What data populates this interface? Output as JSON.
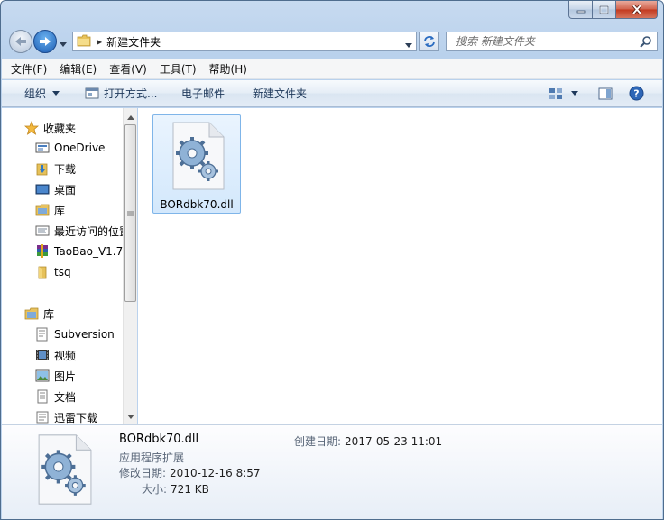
{
  "window": {
    "min_label": "minimize",
    "max_label": "maximize",
    "close_label": "close"
  },
  "address": {
    "path": "新建文件夹"
  },
  "search": {
    "placeholder": "搜索 新建文件夹"
  },
  "menu": [
    "文件(F)",
    "编辑(E)",
    "查看(V)",
    "工具(T)",
    "帮助(H)"
  ],
  "commands": {
    "organize": "组织",
    "open_with": "打开方式...",
    "email": "电子邮件",
    "new_folder": "新建文件夹"
  },
  "nav": {
    "favorites_header": "收藏夹",
    "favorites": [
      "OneDrive",
      "下载",
      "桌面",
      "库",
      "最近访问的位置",
      "TaoBao_V1.7",
      "tsq"
    ],
    "libraries_header": "库",
    "libraries": [
      "Subversion",
      "视频",
      "图片",
      "文档",
      "迅雷下载"
    ]
  },
  "files": [
    {
      "name": "BORdbk70.dll",
      "icon": "dll-gear-icon"
    }
  ],
  "details": {
    "name": "BORdbk70.dll",
    "type": "应用程序扩展",
    "modified_label": "修改日期:",
    "modified_value": "2010-12-16 8:57",
    "size_label": "大小:",
    "size_value": "721 KB",
    "created_label": "创建日期:",
    "created_value": "2017-05-23 11:01"
  },
  "colors": {
    "window_frame": "#b9d1ec",
    "selection": "#d3e8fc",
    "forward_button": "#1c5db4"
  }
}
